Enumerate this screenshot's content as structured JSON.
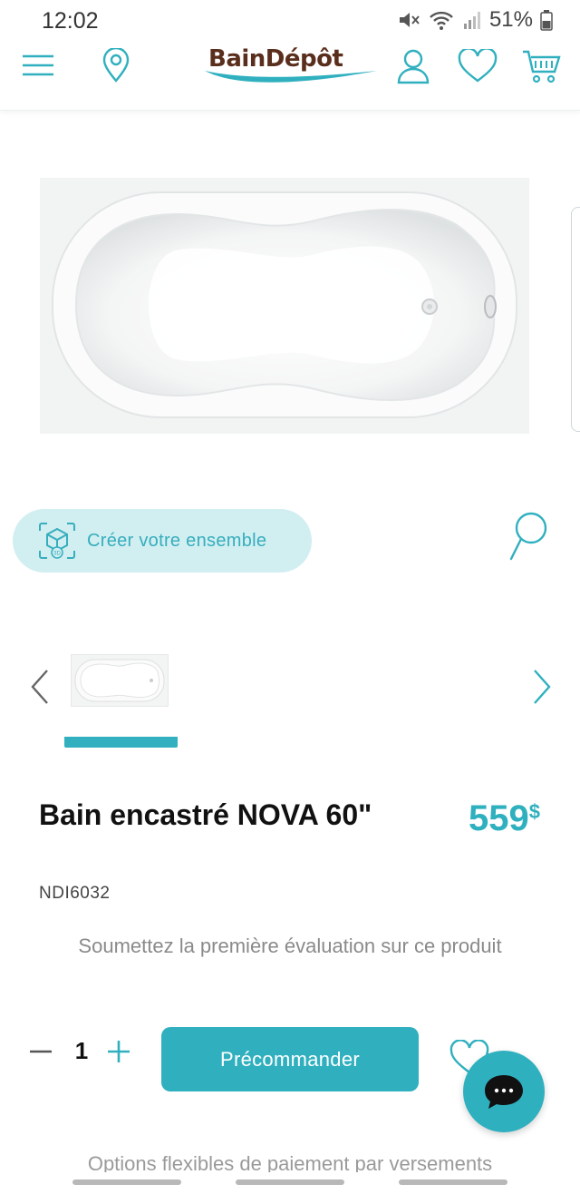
{
  "status_bar": {
    "time": "12:02",
    "battery": "51%",
    "icons": [
      "mute-icon",
      "wifi-icon",
      "signal-icon",
      "battery-icon"
    ]
  },
  "header": {
    "logo": "BainDépôt",
    "icons": [
      "menu-icon",
      "location-icon",
      "account-icon",
      "wishlist-icon",
      "cart-icon"
    ],
    "accent_color": "#30b0bf"
  },
  "gallery": {
    "create_set_label": "Créer votre ensemble",
    "create_set_badge": "3D"
  },
  "product": {
    "title": "Bain encastré NOVA 60\"",
    "price": "559",
    "currency": "$",
    "sku": "NDI6032",
    "review_prompt": "Soumettez la première évaluation sur ce produit"
  },
  "purchase": {
    "quantity": "1",
    "preorder_label": "Précommander"
  },
  "payment_options_text": "Options flexibles de paiement par versements"
}
